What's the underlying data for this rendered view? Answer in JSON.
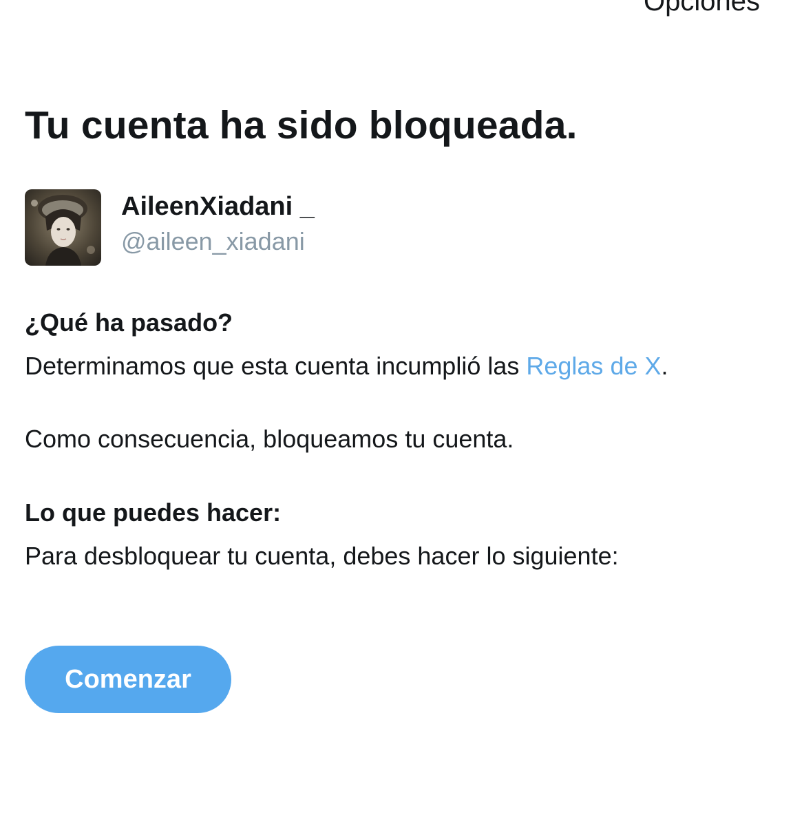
{
  "header": {
    "options_label": "Opciones"
  },
  "title": "Tu cuenta ha sido bloqueada.",
  "account": {
    "display_name": "AileenXiadani _",
    "handle": "@aileen_xiadani"
  },
  "what_happened": {
    "heading": "¿Qué ha pasado?",
    "text_before_link": "Determinamos que esta cuenta incumplió las ",
    "link_label": "Reglas de X",
    "text_after_link": ".",
    "consequence": "Como consecuencia, bloqueamos tu cuenta."
  },
  "what_you_can_do": {
    "heading": "Lo que puedes hacer:",
    "text": "Para desbloquear tu cuenta, debes hacer lo siguiente:"
  },
  "start_button_label": "Comenzar",
  "colors": {
    "link": "#5ea9e8",
    "button": "#55a8ee",
    "handle": "#8899a6",
    "text": "#14171a"
  }
}
